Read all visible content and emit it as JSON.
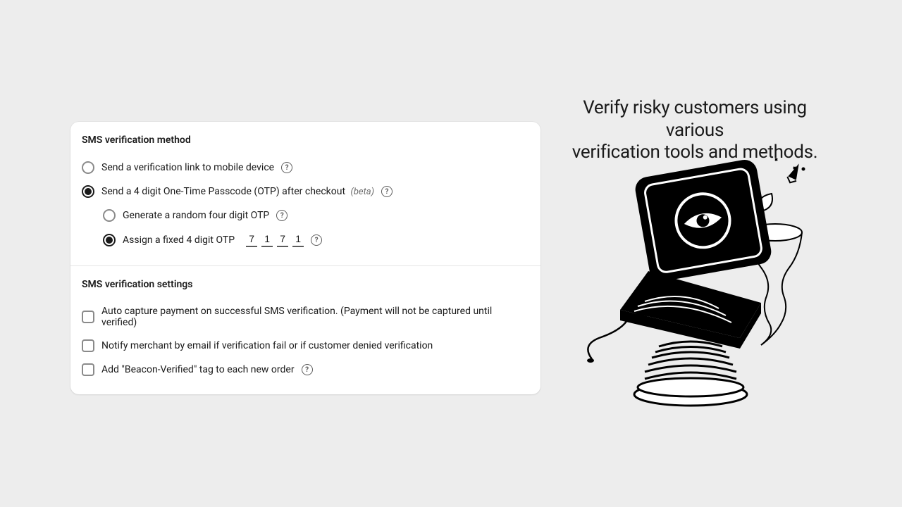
{
  "headline_line1": "Verify risky customers using various",
  "headline_line2": "verification tools and methods.",
  "card": {
    "method": {
      "title": "SMS verification method",
      "options": {
        "link": {
          "label": "Send a verification link to mobile device",
          "selected": false
        },
        "otp": {
          "label": "Send a 4 digit One-Time Passcode (OTP) after checkout",
          "beta": "(beta)",
          "selected": true
        },
        "random_otp": {
          "label": "Generate a random four digit OTP",
          "selected": false
        },
        "fixed_otp": {
          "label": "Assign a fixed 4 digit OTP",
          "selected": true,
          "digits": [
            "7",
            "1",
            "7",
            "1"
          ]
        }
      }
    },
    "settings": {
      "title": "SMS verification settings",
      "options": {
        "auto_capture": {
          "label": "Auto capture payment on successful SMS verification. (Payment will not be captured until verified)",
          "checked": false
        },
        "notify_merchant": {
          "label": "Notify merchant by email if verification fail or if customer denied verification",
          "checked": false
        },
        "add_tag": {
          "label": "Add \"Beacon-Verified\" tag to each new order",
          "checked": false
        }
      }
    }
  }
}
